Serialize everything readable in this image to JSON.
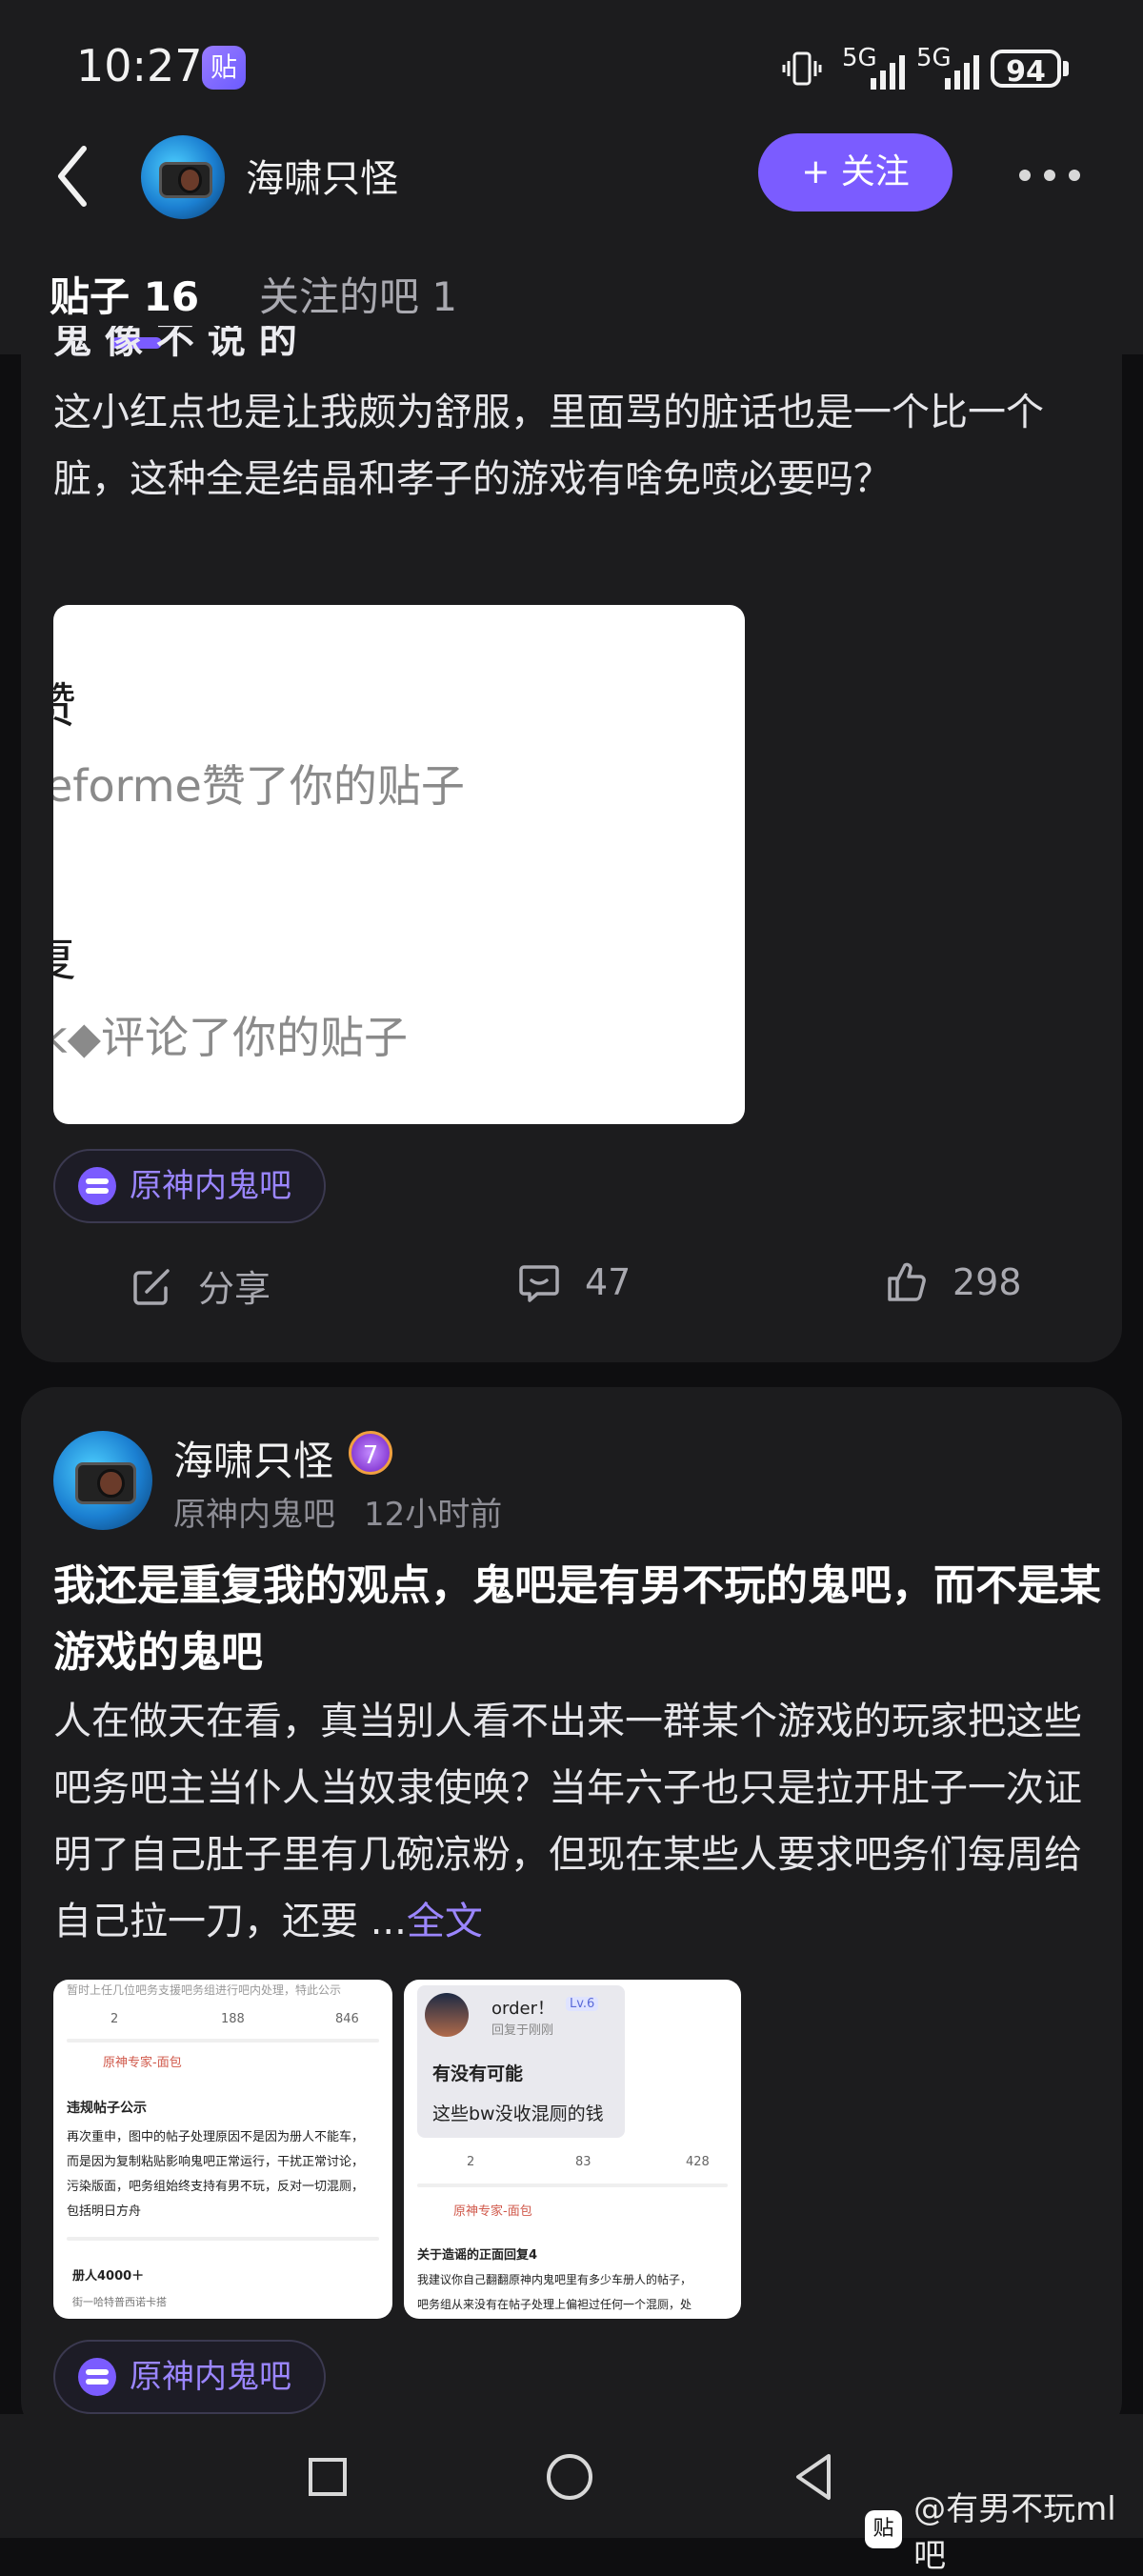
{
  "status": {
    "time": "10:27",
    "app_badge": "贴",
    "sig1": "5G",
    "sig2": "5G",
    "battery": "94"
  },
  "header": {
    "name": "海啸只怪",
    "follow_label": "+ 关注",
    "tabs": [
      {
        "label": "贴子 16",
        "active": true
      },
      {
        "label": "关注的吧 1",
        "active": false
      }
    ]
  },
  "post1": {
    "cut_title": "鬼 像 不 说 的",
    "text": "这小红点也是让我颇为舒服，里面骂的脏话也是一个比一个脏，这种全是结晶和孝子的游戏有啥免喷必要吗？",
    "image": {
      "line1": "赞",
      "line2": "eforme赞了你的贴子",
      "line3": "复",
      "line4": "k◆评论了你的贴子"
    },
    "forum": "原神内鬼吧",
    "share_label": "分享",
    "comments": "47",
    "likes": "298"
  },
  "post2": {
    "author": "海啸只怪",
    "level": "7",
    "forum_meta": "原神内鬼吧",
    "time_meta": "12小时前",
    "title": "我还是重复我的观点，鬼吧是有男不玩的鬼吧，而不是某游戏的鬼吧",
    "text": "人在做天在看，真当别人看不出来一群某个游戏的玩家把这些吧务吧主当仆人当奴隶使唤？当年六子也只是拉开肚子一次证明了自己肚子里有几碗凉粉，但现在某些人要求吧务们每周给自己拉一刀，还要",
    "ellipsis": "...",
    "more_label": "全文",
    "thumb1": {
      "top_line": "暂时上任几位吧务支援吧务组进行吧内处理，特此公示",
      "stat_a": "2",
      "stat_b": "188",
      "stat_c": "846",
      "user": "原神专家-面包",
      "heading": "违规帖子公示",
      "p1": "再次重申，图中的帖子处理原因不是因为册人不能车，",
      "p2": "而是因为复制粘贴影响鬼吧正常运行，干扰正常讨论，",
      "p3": "污染版面，吧务组始终支持有男不玩，反对一切混厕，",
      "p4": "包括明日方舟",
      "bottom1": "册人4000＋",
      "bottom2": "街一哈特普西诺卡搭"
    },
    "thumb2": {
      "reply_user": "order！",
      "reply_level": "Lv.6",
      "reply_meta": "回复于刚刚",
      "q": "有没有可能",
      "a": "这些bw没收混厕的钱",
      "stat_a": "2",
      "stat_b": "83",
      "stat_c": "428",
      "user": "原神专家-面包",
      "heading": "关于造谣的正面回复4",
      "p1": "我建议你自己翻翻原神内鬼吧里有多少车册人的帖子，",
      "p2": "吧务组从来没有在帖子处理上偏袒过任何一个混厕，处"
    },
    "forum": "原神内鬼吧"
  },
  "watermark": {
    "icon": "贴",
    "text": "@有男不玩ml吧"
  }
}
